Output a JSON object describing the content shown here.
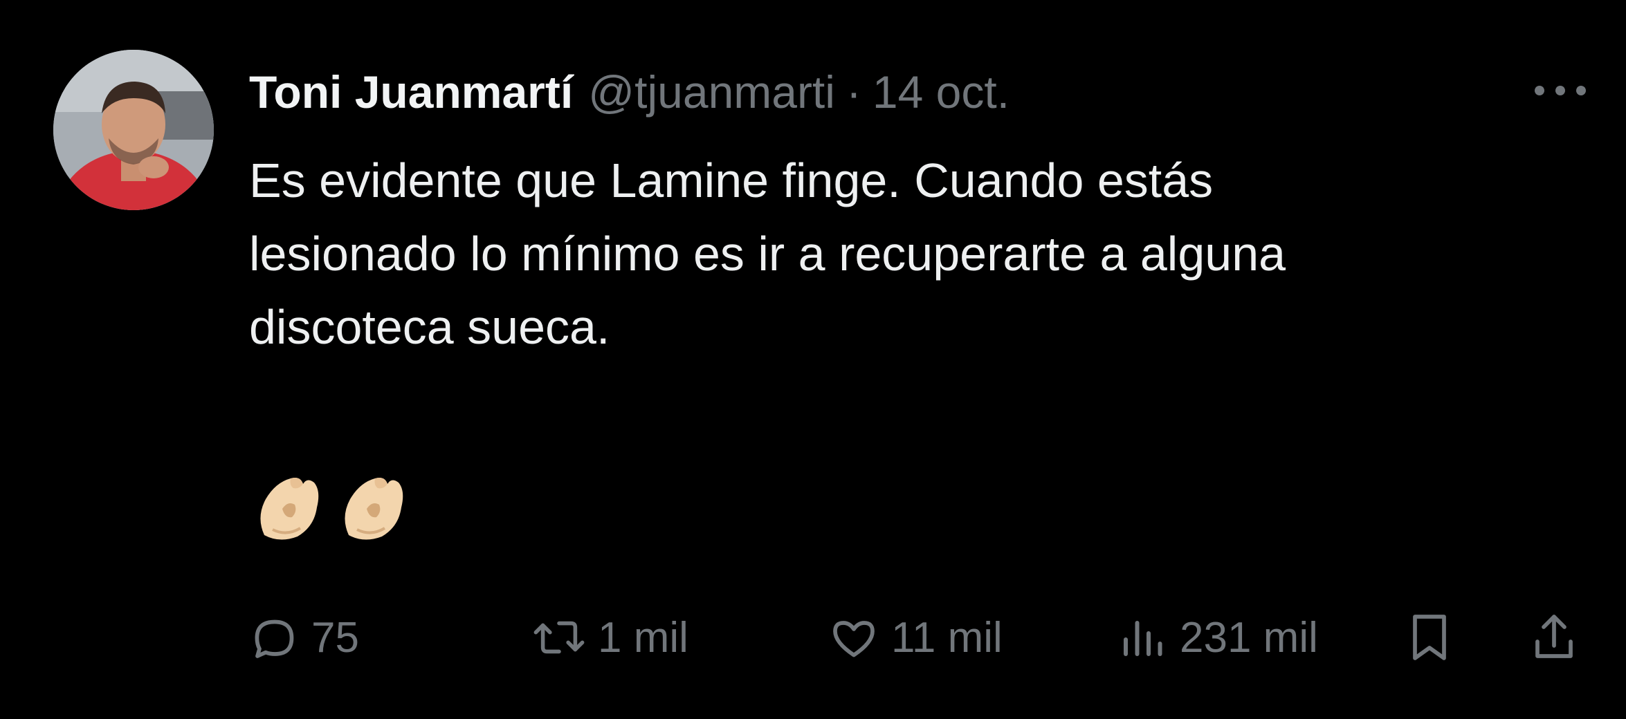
{
  "tweet": {
    "author": {
      "display_name": "Toni Juanmartí",
      "handle": "@tjuanmarti",
      "separator": "·",
      "date": "14 oct."
    },
    "text_lines": [
      "Es evidente que Lamine finge. Cuando estás",
      "lesionado lo mínimo es ir a recuperarte a alguna",
      "discoteca sueca."
    ],
    "emojis": [
      "pinched-fingers-emoji",
      "pinched-fingers-emoji"
    ],
    "more_icon": "more-horizontal-icon",
    "actions": {
      "reply": {
        "icon": "reply-icon",
        "count": "75"
      },
      "retweet": {
        "icon": "retweet-icon",
        "count": "1 mil"
      },
      "like": {
        "icon": "heart-icon",
        "count": "11 mil"
      },
      "views": {
        "icon": "views-chart-icon",
        "count": "231 mil"
      },
      "bookmark": {
        "icon": "bookmark-icon"
      },
      "share": {
        "icon": "share-icon"
      }
    },
    "colors": {
      "background": "#000000",
      "primary_text": "#e7e9ea",
      "secondary_text": "#71767b"
    }
  }
}
